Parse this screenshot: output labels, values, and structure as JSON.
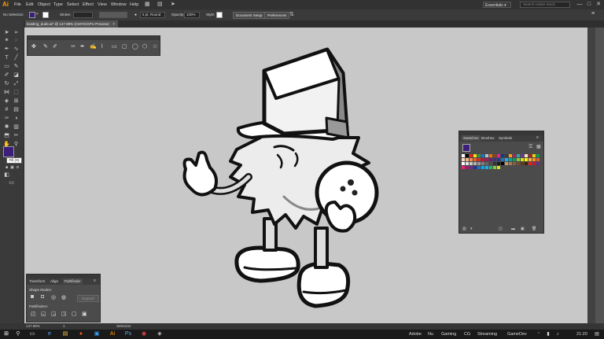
{
  "app": {
    "logo": "Ai"
  },
  "menu": [
    "File",
    "Edit",
    "Object",
    "Type",
    "Select",
    "Effect",
    "View",
    "Window",
    "Help"
  ],
  "workspace": {
    "label": "Essentials ▾",
    "search_placeholder": "Search Adobe Stock"
  },
  "window_controls": {
    "minimize": "—",
    "maximize": "□",
    "close": "✕"
  },
  "control_bar": {
    "selection": "No Selection",
    "stroke_label": "Stroke:",
    "brush": "5 pt. Round",
    "opacity_label": "Opacity:",
    "opacity_value": "100%",
    "style_label": "Style:",
    "doc_setup": "Document Setup",
    "preferences": "Preferences"
  },
  "document_tab": {
    "title": "bowling_dude.ai* @ 147.98% (CMYK/GPU Preview)",
    "close": "✕"
  },
  "tools_panel": {
    "tooltip": "Fill (X)"
  },
  "swatches_panel": {
    "tabs": [
      "Swatches",
      "Brushes",
      "Symbols"
    ],
    "colors_row1": [
      "#ffffff",
      "#000000",
      "#e8231f",
      "#f6e50e",
      "#2a9b3c",
      "#1e6fd0",
      "#c0c0c0",
      "#ff6d00",
      "#8b4513",
      "#ff1493",
      "#0b3b8c",
      "#3a3a3a",
      "#f9a01b",
      "#b01e6a",
      "#2aa9a0",
      "#6a3d9a",
      "#ffe4c4",
      "#a52a2a",
      "#ffcc00",
      "#00a651"
    ],
    "colors_row2": [
      "#fdd6c2",
      "#f7b386",
      "#f48a48",
      "#ef5b24",
      "#e02b2b",
      "#c4123e",
      "#9b1d5b",
      "#6d2077",
      "#4a2a8a",
      "#2b3990",
      "#1b75bb",
      "#27aae1",
      "#00a79d",
      "#00a651",
      "#8dc63f",
      "#d7df23",
      "#fff200",
      "#fbb040",
      "#f7941d",
      "#f15a29"
    ],
    "colors_row3": [
      "#ffffff",
      "#e6e6e6",
      "#cccccc",
      "#b3b3b3",
      "#999999",
      "#808080",
      "#666666",
      "#4d4d4d",
      "#333333",
      "#1a1a1a",
      "#000000",
      "#c49a6c",
      "#a97c50",
      "#8b5e3c",
      "#754c29",
      "#603913",
      "#42210b",
      "#ed1c24",
      "#be1e2d",
      "#662d91"
    ],
    "colors_row4": [
      "#ed1e79",
      "#9e1f63",
      "#662d91",
      "#2e3192",
      "#1c75bc",
      "#00aeef",
      "#29abe2",
      "#22b573",
      "#8cc63f",
      "#d9e021"
    ]
  },
  "pathfinder_panel": {
    "tabs": [
      "Transform",
      "Align",
      "Pathfinder"
    ],
    "shape_modes": "Shape Modes:",
    "expand": "Expand",
    "pathfinders": "Pathfinders:"
  },
  "status_bar": {
    "zoom": "147.98%",
    "artboard": "1",
    "mode": "Selection"
  },
  "taskbar": {
    "items": [
      "Adobe",
      "Nu",
      "Gaming",
      "CG",
      "Streaming",
      "GameDev"
    ],
    "time": "21:20"
  }
}
